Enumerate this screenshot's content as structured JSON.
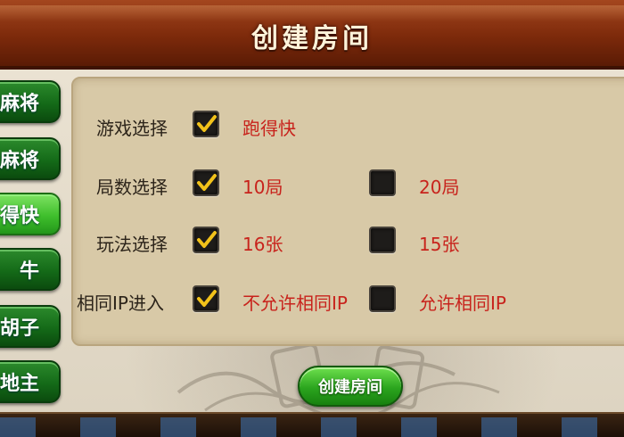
{
  "header": {
    "title": "创建房间"
  },
  "sidebar": {
    "items": [
      {
        "label": "麻将",
        "active": false
      },
      {
        "label": "麻将",
        "active": false
      },
      {
        "label": "得快",
        "active": true
      },
      {
        "label": "牛",
        "active": false
      },
      {
        "label": "胡子",
        "active": false
      },
      {
        "label": "地主",
        "active": false
      }
    ]
  },
  "options": {
    "game": {
      "label": "游戏选择",
      "choice1": {
        "text": "跑得快",
        "checked": true
      }
    },
    "rounds": {
      "label": "局数选择",
      "choice1": {
        "text": "10局",
        "checked": true
      },
      "choice2": {
        "text": "20局",
        "checked": false
      }
    },
    "play": {
      "label": "玩法选择",
      "choice1": {
        "text": "16张",
        "checked": true
      },
      "choice2": {
        "text": "15张",
        "checked": false
      }
    },
    "ip": {
      "label": "相同IP进入",
      "choice1": {
        "text": "不允许相同IP",
        "checked": true
      },
      "choice2": {
        "text": "允许相同IP",
        "checked": false
      }
    }
  },
  "actions": {
    "create_label": "创建房间"
  },
  "colors": {
    "accent_red": "#c8231c",
    "button_green": "#2ba51e",
    "title_brown": "#7d2a0b"
  },
  "icons": {
    "check": "check-icon"
  }
}
